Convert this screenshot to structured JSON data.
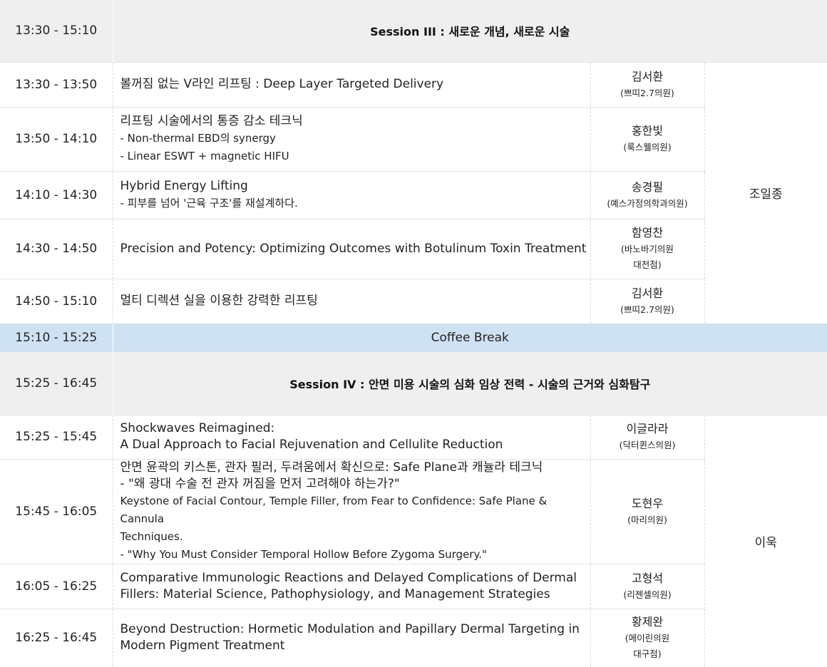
{
  "session3": {
    "time": "13:30 - 15:10",
    "title": "Session III : 새로운 개념, 새로운 시술",
    "chair": "조일종",
    "talks": [
      {
        "time": "13:30 - 13:50",
        "title": "볼꺼짐 없는 V라인 리프팅 : Deep Layer Targeted Delivery",
        "subs": [],
        "speaker": "김서환",
        "aff": [
          "(쁘띠2.7의원)"
        ]
      },
      {
        "time": "13:50 - 14:10",
        "title": "리프팅 시술에서의 통증 감소 테크닉",
        "subs": [
          "- Non-thermal EBD의 synergy",
          "- Linear ESWT + magnetic HIFU"
        ],
        "speaker": "홍한빛",
        "aff": [
          "(룩스웰의원)"
        ]
      },
      {
        "time": "14:10 - 14:30",
        "title": "Hybrid Energy Lifting",
        "subs": [
          "- 피부를 넘어 '근육 구조'를 재설계하다."
        ],
        "speaker": "송경필",
        "aff": [
          "(예스가정의학과의원)"
        ]
      },
      {
        "time": "14:30 - 14:50",
        "title": "Precision and Potency: Optimizing Outcomes with Botulinum Toxin Treatment",
        "subs": [],
        "speaker": "함영찬",
        "aff": [
          "(바노바기의원",
          "대전점)"
        ]
      },
      {
        "time": "14:50 - 15:10",
        "title": "멀티 디렉션 실을 이용한 강력한 리프팅",
        "subs": [],
        "speaker": "김서환",
        "aff": [
          "(쁘띠2.7의원)"
        ]
      }
    ]
  },
  "coffee_break": {
    "time": "15:10 - 15:25",
    "label": "Coffee Break"
  },
  "session4": {
    "time": "15:25 - 16:45",
    "title": "Session IV : 안면 미용 시술의 심화 임상 전력 - 시술의 근거와 심화탐구",
    "chair": "이욱",
    "talks": [
      {
        "time": "15:25 - 15:45",
        "title_lines": [
          "Shockwaves Reimagined:",
          "A Dual Approach to Facial Rejuvenation and Cellulite Reduction"
        ],
        "subs": [],
        "speaker": "이글라라",
        "aff": [
          "(닥터퀸스의원)"
        ]
      },
      {
        "time": "15:45 - 16:05",
        "title_lines": [
          "안면 윤곽의 키스톤, 관자 필러, 두려움에서 확신으로: Safe Plane과 캐뉼라 테크닉",
          "- \"왜 광대 수술 전 관자 꺼짐을 먼저 고려해야 하는가?\""
        ],
        "subs": [
          "Keystone of Facial Contour, Temple Filler, from Fear to Confidence: Safe Plane & Cannula",
          "Techniques.",
          "- \"Why You Must Consider Temporal Hollow Before Zygoma Surgery.\""
        ],
        "speaker": "도현우",
        "aff": [
          "(마리의원)"
        ]
      },
      {
        "time": "16:05 - 16:25",
        "title_lines": [
          "Comparative Immunologic Reactions and Delayed Complications of Dermal",
          "Fillers: Material Science, Pathophysiology, and Management Strategies"
        ],
        "subs": [],
        "speaker": "고형석",
        "aff": [
          "(리젠셀의원)"
        ]
      },
      {
        "time": "16:25 - 16:45",
        "title_lines": [
          "Beyond Destruction: Hormetic Modulation and Papillary Dermal Targeting in",
          "Modern Pigment Treatment"
        ],
        "subs": [],
        "speaker": "황제완",
        "aff": [
          "(메이린의원",
          "대구점)"
        ]
      }
    ]
  }
}
